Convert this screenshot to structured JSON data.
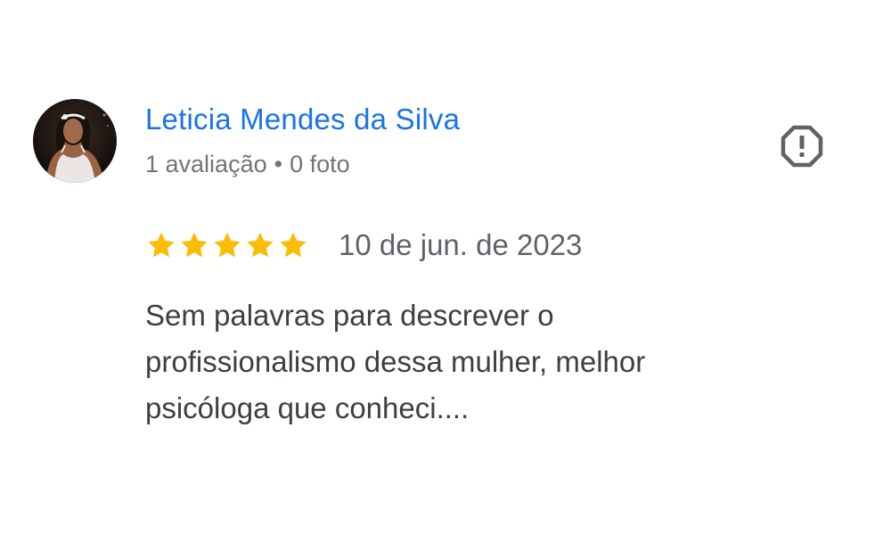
{
  "review": {
    "author": {
      "name": "Leticia Mendes da Silva",
      "review_count": "1 avaliação",
      "separator": "•",
      "photo_count": "0 foto",
      "avatar": "profile-photo"
    },
    "rating": {
      "value": 5,
      "max": 5,
      "star_color": "#fbbc04"
    },
    "date": "10 de jun. de 2023",
    "text": "Sem palavras para descrever o\nprofissionalismo dessa mulher, melhor\npsicóloga que conheci....",
    "report_icon": "report-octagon-icon"
  },
  "colors": {
    "name": "#1a73e8",
    "meta": "#70757a",
    "date": "#5f6368",
    "text": "#3c4043",
    "icon": "#5f6368"
  }
}
